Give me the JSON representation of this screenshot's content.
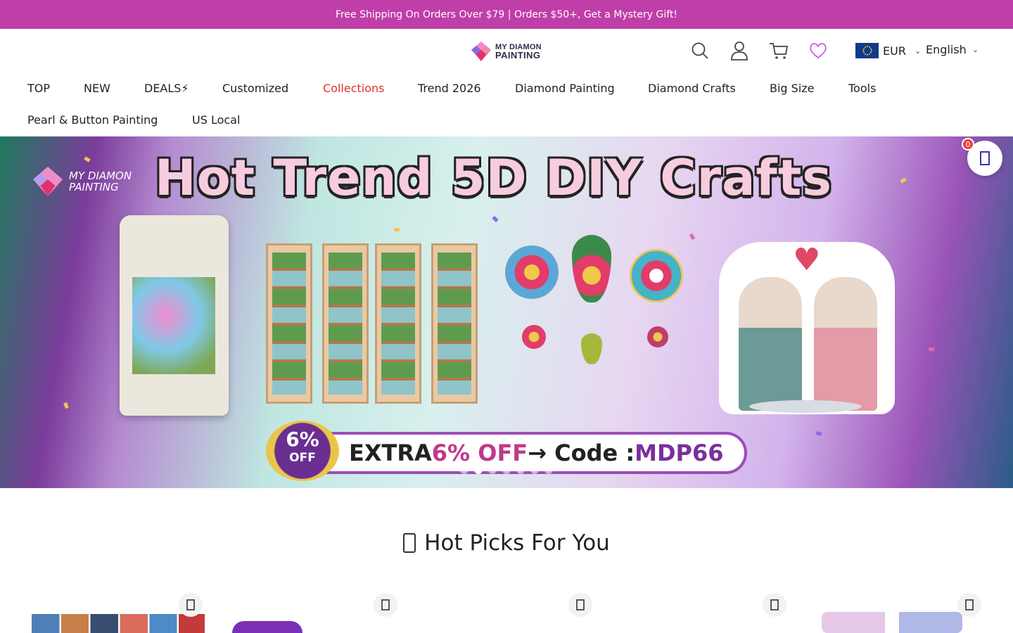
{
  "announcement": "Free Shipping On Orders Over $79 | Orders $50+, Get a Mystery Gift!",
  "header": {
    "logo_line1": "MY DIAMON",
    "logo_line2": "PAINTING",
    "currency": "EUR",
    "language": "English",
    "icons": [
      "search-icon",
      "account-icon",
      "cart-icon",
      "wishlist-heart-icon",
      "eu-flag-icon"
    ]
  },
  "nav": [
    {
      "label": "TOP",
      "active": false
    },
    {
      "label": "NEW",
      "active": false
    },
    {
      "label": "DEALS⚡",
      "active": false
    },
    {
      "label": "Customized",
      "active": false
    },
    {
      "label": "Collections",
      "active": true
    },
    {
      "label": "Trend 2026",
      "active": false
    },
    {
      "label": "Diamond Painting",
      "active": false
    },
    {
      "label": "Diamond Crafts",
      "active": false
    },
    {
      "label": "Big Size",
      "active": false
    },
    {
      "label": "Tools",
      "active": false
    },
    {
      "label": "Pearl & Button Painting",
      "active": false
    },
    {
      "label": "US Local",
      "active": false
    }
  ],
  "hero": {
    "title": "Hot Trend 5D DIY Crafts",
    "brand_line1": "MY DIAMON",
    "brand_line2": "PAINTING",
    "badge_percent": "6%",
    "badge_off": "OFF",
    "promo_extra": "EXTRA ",
    "promo_pct": "6% OFF",
    "promo_arrow": " → Code : ",
    "promo_code": "MDP66",
    "slides_count": 7,
    "active_slide": 1
  },
  "wishlist_float": {
    "count": "0"
  },
  "section": {
    "title": "Hot Picks For You"
  },
  "colors": {
    "announcement_bg": "#c03ea8",
    "active_nav": "#e0322d",
    "heart": "#c860d8",
    "badge": "#e8413a"
  }
}
